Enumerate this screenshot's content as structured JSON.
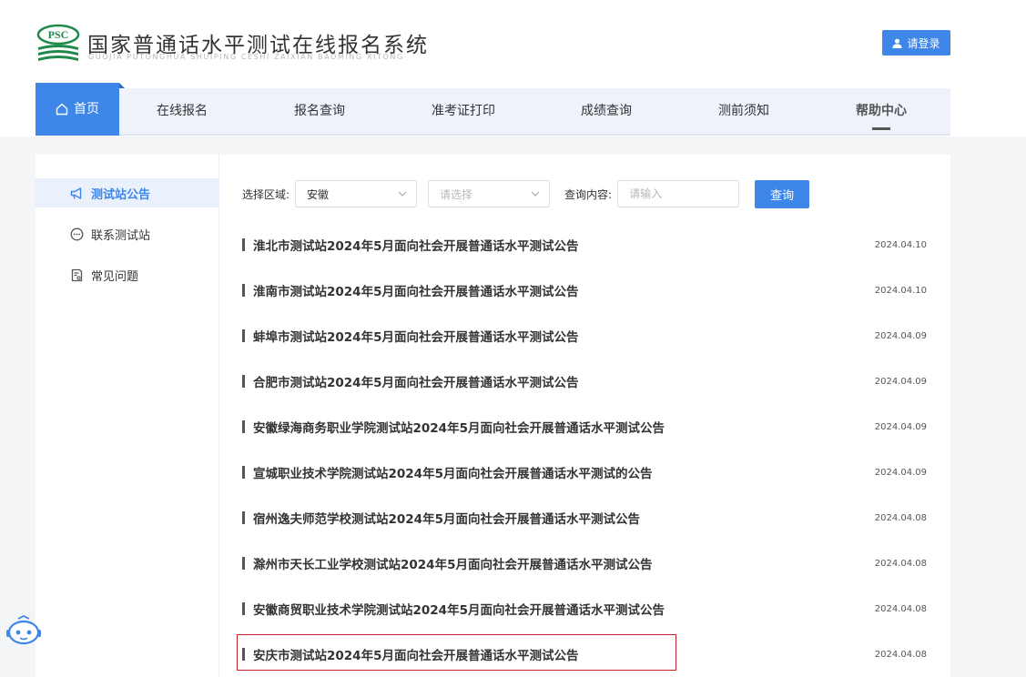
{
  "header": {
    "logo_text": "PSC",
    "title": "国家普通话水平测试在线报名系统",
    "subtitle": "GUOJIA PUTONGHUA SHUIPING CESHI ZAIXIAN BAOMING XITONG",
    "login_label": "请登录"
  },
  "nav": {
    "items": [
      "首页",
      "在线报名",
      "报名查询",
      "准考证打印",
      "成绩查询",
      "测前须知",
      "帮助中心"
    ],
    "active": "首页"
  },
  "sidebar": {
    "items": [
      {
        "label": "测试站公告",
        "icon": "megaphone-icon",
        "active": true
      },
      {
        "label": "联系测试站",
        "icon": "chat-icon",
        "active": false
      },
      {
        "label": "常见问题",
        "icon": "document-question-icon",
        "active": false
      }
    ]
  },
  "filters": {
    "region_label": "选择区域:",
    "province_value": "安徽",
    "city_placeholder": "请选择",
    "query_label": "查询内容:",
    "query_placeholder": "请输入",
    "query_button": "查询"
  },
  "announcements": [
    {
      "title": "淮北市测试站2024年5月面向社会开展普通话水平测试公告",
      "date": "2024.04.10"
    },
    {
      "title": "淮南市测试站2024年5月面向社会开展普通话水平测试公告",
      "date": "2024.04.10"
    },
    {
      "title": "蚌埠市测试站2024年5月面向社会开展普通话水平测试公告",
      "date": "2024.04.09"
    },
    {
      "title": "合肥市测试站2024年5月面向社会开展普通话水平测试公告",
      "date": "2024.04.09"
    },
    {
      "title": "安徽绿海商务职业学院测试站2024年5月面向社会开展普通话水平测试公告",
      "date": "2024.04.09"
    },
    {
      "title": "宣城职业技术学院测试站2024年5月面向社会开展普通话水平测试的公告",
      "date": "2024.04.09"
    },
    {
      "title": "宿州逸夫师范学校测试站2024年5月面向社会开展普通话水平测试公告",
      "date": "2024.04.08"
    },
    {
      "title": "滁州市天长工业学校测试站2024年5月面向社会开展普通话水平测试公告",
      "date": "2024.04.08"
    },
    {
      "title": "安徽商贸职业技术学院测试站2024年5月面向社会开展普通话水平测试公告",
      "date": "2024.04.08"
    },
    {
      "title": "安庆市测试站2024年5月面向社会开展普通话水平测试公告",
      "date": "2024.04.08"
    }
  ],
  "colors": {
    "primary": "#3e86e8",
    "logo_green": "#1f8a4c",
    "highlight_border": "#c8202a"
  }
}
